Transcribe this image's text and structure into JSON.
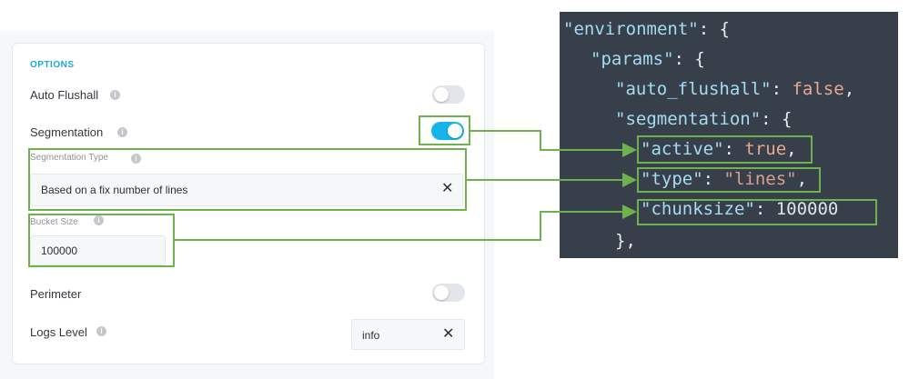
{
  "options": {
    "section_title": "OPTIONS",
    "auto_flushall": {
      "label": "Auto Flushall",
      "active": false
    },
    "segmentation": {
      "label": "Segmentation",
      "active": true
    },
    "segmentation_type": {
      "label": "Segmentation Type",
      "value": "Based on a fix number of lines"
    },
    "bucket_size": {
      "label": "Bucket Size",
      "value": "100000"
    },
    "perimeter": {
      "label": "Perimeter",
      "active": false
    },
    "logs_level": {
      "label": "Logs Level",
      "value": "info"
    }
  },
  "icons": {
    "info": "info-icon",
    "clear": "close-icon"
  },
  "code": {
    "line1_key": "\"environment\"",
    "line1_rest": ": {",
    "line2_key": "\"params\"",
    "line2_rest": ": {",
    "line3_key": "\"auto_flushall\"",
    "line3_colon": ": ",
    "line3_value": "false",
    "line3_comma": ",",
    "line4_key": "\"segmentation\"",
    "line4_rest": ": {",
    "line5_key": "\"active\"",
    "line5_colon": ": ",
    "line5_value": "true",
    "line5_comma": ",",
    "line6_key": "\"type\"",
    "line6_colon": ": ",
    "line6_value": "\"lines\"",
    "line6_comma": ",",
    "line7_key": "\"chunksize\"",
    "line7_colon": ": ",
    "line7_value": "100000",
    "line8": "},"
  },
  "colors": {
    "accent": "#16b4e8",
    "highlight": "#6fb04f",
    "code_bg": "#37404a"
  }
}
